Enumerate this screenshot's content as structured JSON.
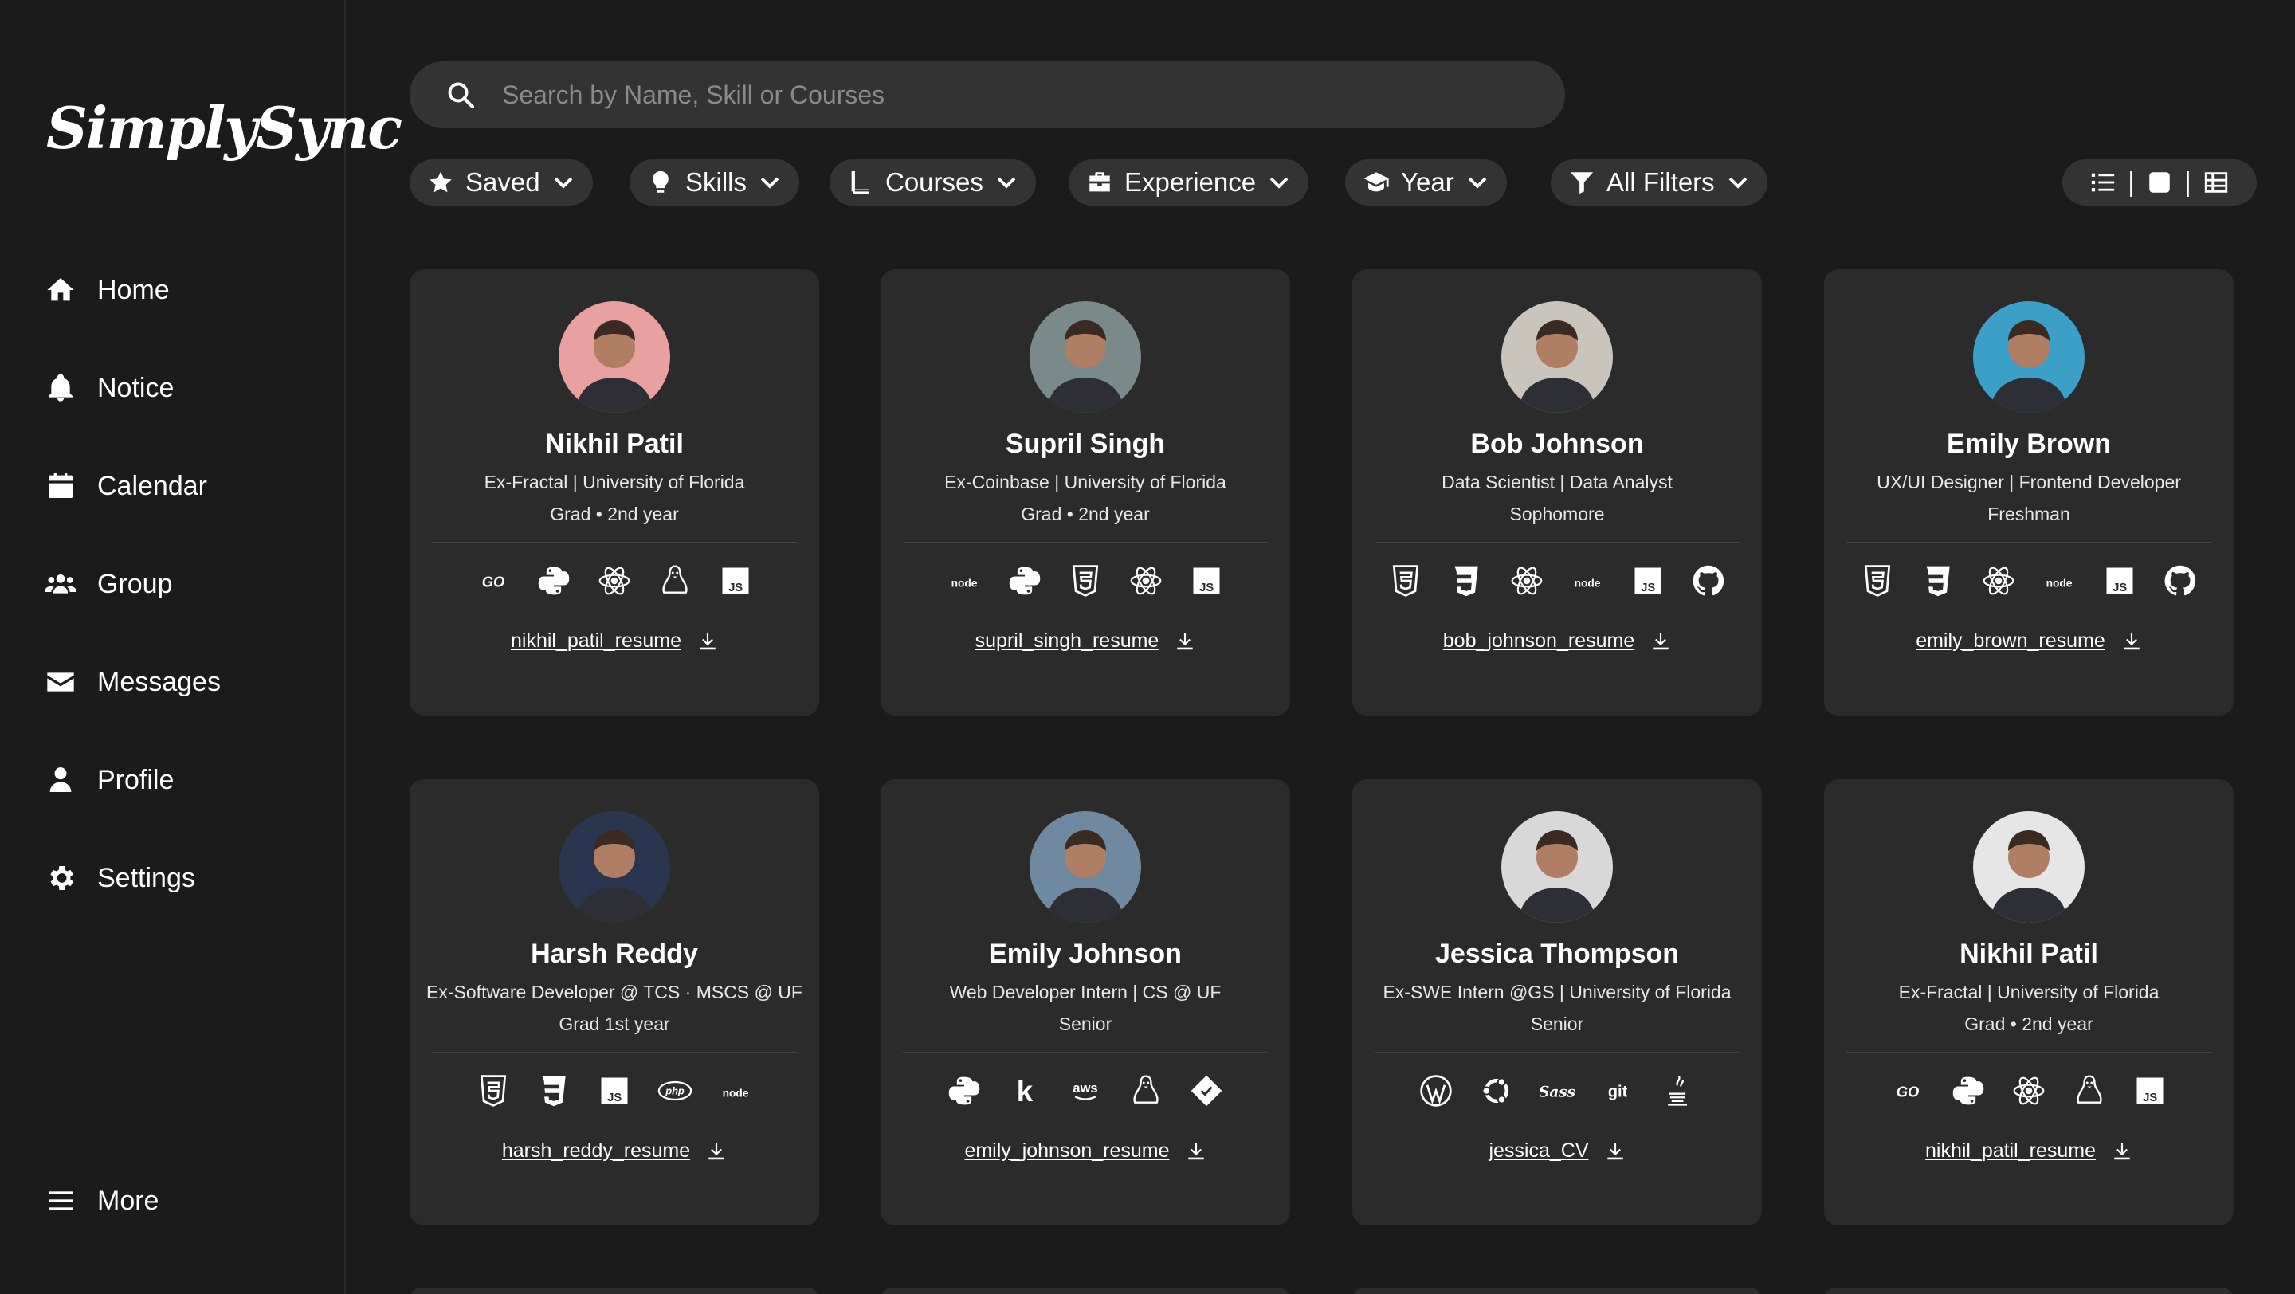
{
  "app": {
    "logo": "SimplySync"
  },
  "sidebar": {
    "items": [
      {
        "label": "Home",
        "icon": "home-icon"
      },
      {
        "label": "Notice",
        "icon": "bell-icon"
      },
      {
        "label": "Calendar",
        "icon": "calendar-icon"
      },
      {
        "label": "Group",
        "icon": "group-icon"
      },
      {
        "label": "Messages",
        "icon": "envelope-icon"
      },
      {
        "label": "Profile",
        "icon": "user-icon"
      },
      {
        "label": "Settings",
        "icon": "gear-icon"
      }
    ],
    "more": "More"
  },
  "search": {
    "placeholder": "Search by Name, Skill or Courses",
    "value": ""
  },
  "filters": [
    {
      "label": "Saved",
      "icon": "star-icon"
    },
    {
      "label": "Skills",
      "icon": "lightbulb-icon"
    },
    {
      "label": "Courses",
      "icon": "book-icon"
    },
    {
      "label": "Experience",
      "icon": "briefcase-icon"
    },
    {
      "label": "Year",
      "icon": "graduation-cap-icon"
    },
    {
      "label": "All Filters",
      "icon": "funnel-icon"
    }
  ],
  "view_toggle": {
    "separator": "|",
    "options": [
      "list-view-icon",
      "single-view-icon",
      "grid-view-icon"
    ]
  },
  "cards": [
    {
      "name": "Nikhil Patil",
      "title": "Ex-Fractal | University of Florida",
      "year": "Grad • 2nd year",
      "skills": [
        "go-icon",
        "python-icon",
        "react-icon",
        "linux-icon",
        "javascript-icon"
      ],
      "resume": "nikhil_patil_resume",
      "avatar_bg": "#e8a0a0"
    },
    {
      "name": "Supril Singh",
      "title": "Ex-Coinbase | University of Florida",
      "year": "Grad • 2nd year",
      "skills": [
        "nodejs-icon",
        "python-icon",
        "html5-icon",
        "react-icon",
        "javascript-icon"
      ],
      "resume": "supril_singh_resume",
      "avatar_bg": "#7a8a8a"
    },
    {
      "name": "Bob Johnson",
      "title": "Data Scientist | Data Analyst",
      "year": "Sophomore",
      "skills": [
        "html5-icon",
        "css3-icon",
        "react-icon",
        "nodejs-icon",
        "javascript-icon",
        "github-icon"
      ],
      "resume": "bob_johnson_resume",
      "avatar_bg": "#c9c4bc"
    },
    {
      "name": "Emily Brown",
      "title": "UX/UI Designer | Frontend Developer",
      "year": "Freshman",
      "skills": [
        "html5-icon",
        "css3-icon",
        "react-icon",
        "nodejs-icon",
        "javascript-icon",
        "github-icon"
      ],
      "resume": "emily_brown_resume",
      "avatar_bg": "#3aa0c8"
    },
    {
      "name": "Harsh Reddy",
      "title": "Ex-Software Developer @ TCS · MSCS @ UF",
      "year": "Grad 1st year",
      "skills": [
        "html5-icon",
        "css3-icon",
        "javascript-icon",
        "php-icon",
        "nodejs-icon"
      ],
      "resume": "harsh_reddy_resume",
      "avatar_bg": "#2a3550"
    },
    {
      "name": "Emily Johnson",
      "title": "Web Developer Intern | CS @ UF",
      "year": "Senior",
      "skills": [
        "python-icon",
        "kotlin-icon",
        "aws-icon",
        "linux-icon",
        "diamond-icon"
      ],
      "resume": "emily_johnson_resume",
      "avatar_bg": "#6f8aa0"
    },
    {
      "name": "Jessica Thompson",
      "title": "Ex-SWE Intern @GS | University of Florida",
      "year": "Senior",
      "skills": [
        "wordpress-icon",
        "ubuntu-icon",
        "sass-icon",
        "git-icon",
        "java-icon"
      ],
      "resume": "jessica_CV",
      "avatar_bg": "#d8d8d8"
    },
    {
      "name": "Nikhil Patil",
      "title": "Ex-Fractal | University of Florida",
      "year": "Grad • 2nd year",
      "skills": [
        "go-icon",
        "python-icon",
        "react-icon",
        "linux-icon",
        "javascript-icon"
      ],
      "resume": "nikhil_patil_resume",
      "avatar_bg": "#e6e6e6"
    }
  ],
  "skill_labels": {
    "go": "GO",
    "js": "JS",
    "node": "node",
    "aws": "aws",
    "git": "git",
    "php": "php",
    "kotlin": "k",
    "sass": "Sass"
  }
}
